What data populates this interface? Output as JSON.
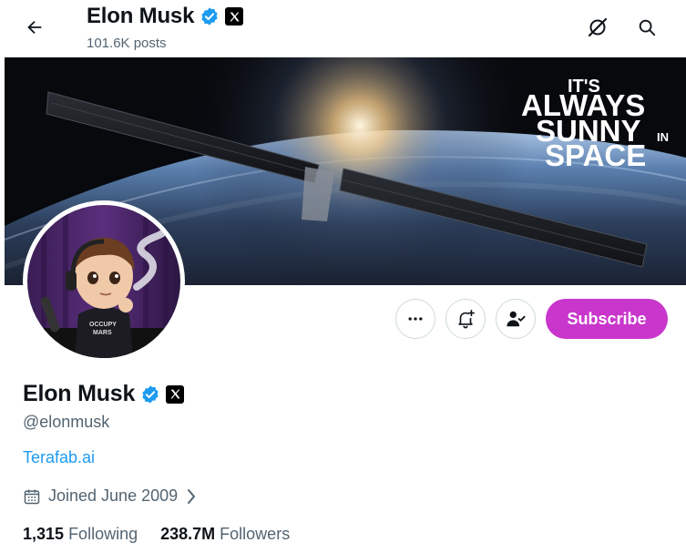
{
  "header": {
    "name": "Elon Musk",
    "posts": "101.6K posts"
  },
  "banner": {
    "text_line1": "IT'S",
    "text_line2": "ALWAYS",
    "text_line3": "SUNNY",
    "text_line3_small": "IN",
    "text_line4": "SPACE"
  },
  "avatar": {
    "shirt_line1": "OCCUPY",
    "shirt_line2": "MARS"
  },
  "actions": {
    "subscribe_label": "Subscribe",
    "subscribe_color": "#c936cc"
  },
  "profile": {
    "name": "Elon Musk",
    "handle": "@elonmusk",
    "link": "Terafab.ai",
    "joined": "Joined June 2009",
    "following_count": "1,315",
    "following_label": "Following",
    "followers_count": "238.7M",
    "followers_label": "Followers"
  },
  "icons": {
    "back": "arrow-left-icon",
    "grok": "grok-icon",
    "search": "search-icon",
    "verified": "verified-badge-icon",
    "affiliate": "x-logo-icon",
    "more": "more-dots-icon",
    "notify": "bell-plus-icon",
    "following": "person-check-icon",
    "calendar": "calendar-icon",
    "chevron": "chevron-right-icon"
  },
  "colors": {
    "link": "#1d9bf0",
    "verified": "#1d9bf0",
    "secondary_text": "#536471"
  }
}
